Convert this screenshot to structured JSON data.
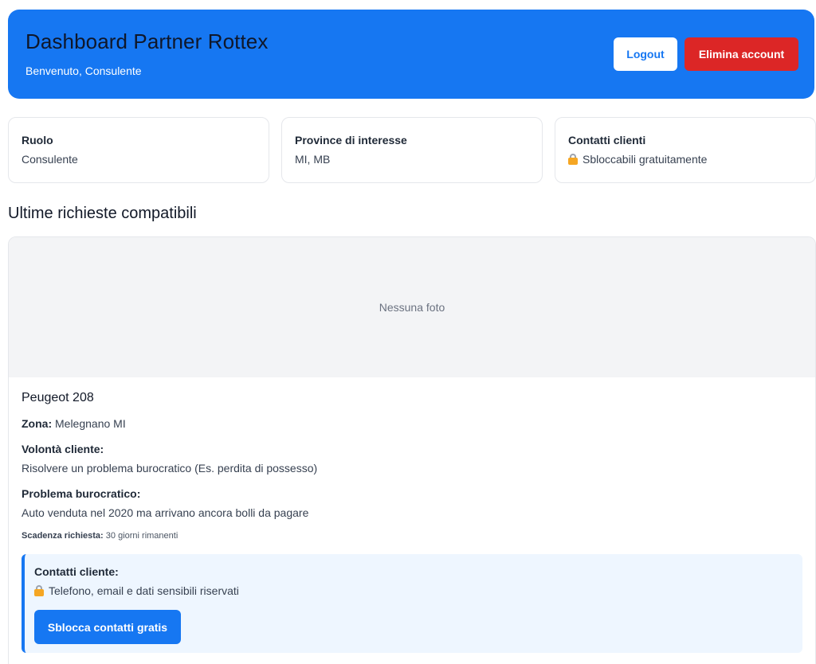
{
  "header": {
    "title": "Dashboard Partner Rottex",
    "subtitle": "Benvenuto, Consulente",
    "logout_label": "Logout",
    "delete_label": "Elimina account"
  },
  "info_cards": [
    {
      "label": "Ruolo",
      "value": "Consulente"
    },
    {
      "label": "Province di interesse",
      "value": "MI, MB"
    },
    {
      "label": "Contatti clienti",
      "value": "Sbloccabili gratuitamente",
      "icon": "lock-icon"
    }
  ],
  "section_title": "Ultime richieste compatibili",
  "request": {
    "photo_placeholder": "Nessuna foto",
    "car": "Peugeot 208",
    "zona_label": "Zona:",
    "zona_value": "Melegnano MI",
    "volonta_label": "Volontà cliente:",
    "volonta_value": "Risolvere un problema burocratico (Es. perdita di possesso)",
    "problema_label": "Problema burocratico:",
    "problema_value": "Auto venduta nel 2020 ma arrivano ancora bolli da pagare",
    "scadenza_label": "Scadenza richiesta:",
    "scadenza_value": "30 giorni rimanenti",
    "contacts": {
      "label": "Contatti cliente:",
      "value": "Telefono, email e dati sensibili riservati",
      "icon": "lock-icon",
      "button_label": "Sblocca contatti gratis"
    }
  },
  "colors": {
    "primary": "#1677f2",
    "danger": "#dc2626",
    "contact_bg": "#eef6ff",
    "placeholder_bg": "#f3f4f6"
  }
}
